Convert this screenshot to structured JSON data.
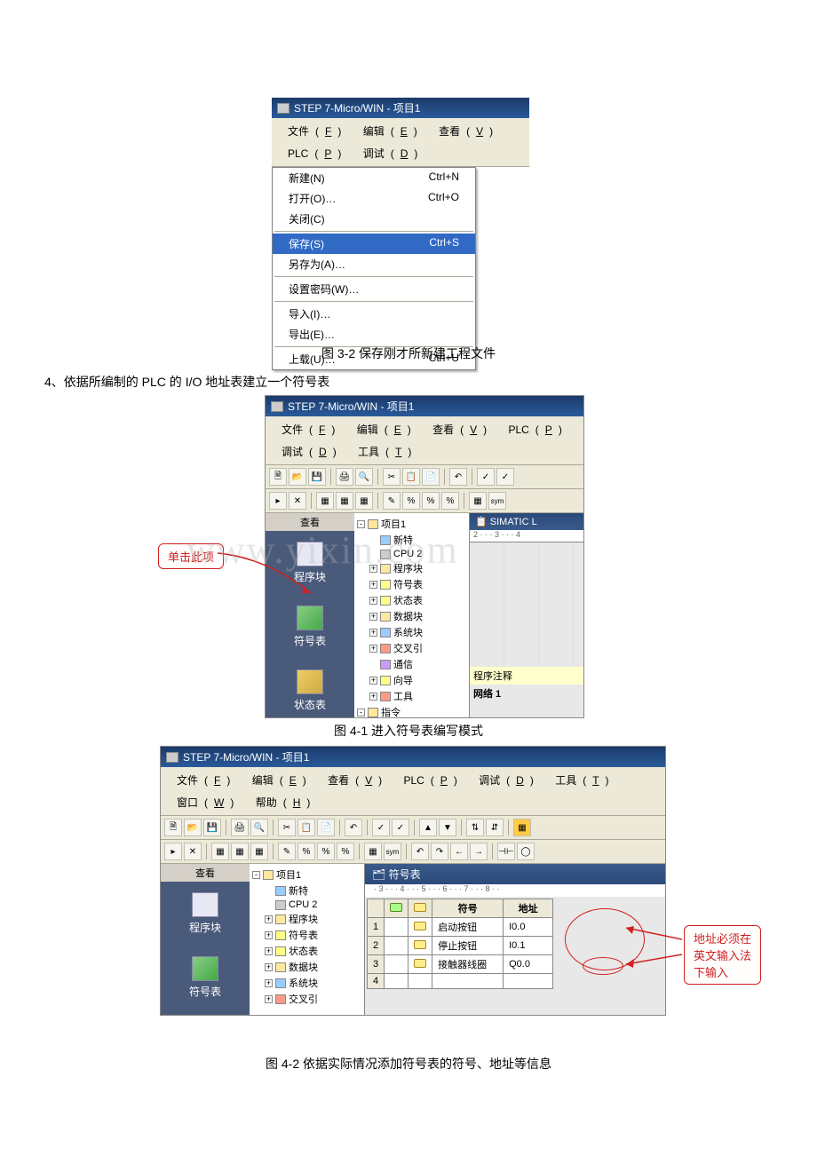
{
  "fig32": {
    "title": "STEP 7-Micro/WIN - 项目1",
    "menubar": [
      {
        "label": "文件",
        "u": "F"
      },
      {
        "label": "编辑",
        "u": "E"
      },
      {
        "label": "查看",
        "u": "V"
      },
      {
        "label": "PLC",
        "u": "P"
      },
      {
        "label": "调试",
        "u": "D"
      }
    ],
    "menuItems": [
      {
        "label": "新建(N)",
        "shortcut": "Ctrl+N"
      },
      {
        "label": "打开(O)…",
        "shortcut": "Ctrl+O"
      },
      {
        "label": "关闭(C)",
        "shortcut": ""
      },
      {
        "sep": true
      },
      {
        "label": "保存(S)",
        "shortcut": "Ctrl+S",
        "hl": true
      },
      {
        "label": "另存为(A)…",
        "shortcut": ""
      },
      {
        "sep": true
      },
      {
        "label": "设置密码(W)…",
        "shortcut": ""
      },
      {
        "sep": true
      },
      {
        "label": "导入(I)…",
        "shortcut": ""
      },
      {
        "label": "导出(E)…",
        "shortcut": ""
      },
      {
        "sep": true
      },
      {
        "label": "上载(U)…",
        "shortcut": "Ctrl+U"
      }
    ],
    "caption": "图 3-2   保存刚才所新建工程文件"
  },
  "instruction4": "4、依据所编制的 PLC 的 I/O 地址表建立一个符号表",
  "fig41": {
    "title": "STEP 7-Micro/WIN - 项目1",
    "menubar": [
      {
        "label": "文件",
        "u": "F"
      },
      {
        "label": "编辑",
        "u": "E"
      },
      {
        "label": "查看",
        "u": "V"
      },
      {
        "label": "PLC",
        "u": "P"
      },
      {
        "label": "调试",
        "u": "D"
      },
      {
        "label": "工具",
        "u": "T"
      }
    ],
    "viewHeader": "查看",
    "viewItems": [
      {
        "label": "程序块",
        "icon": "prog"
      },
      {
        "label": "符号表",
        "icon": "symbol"
      },
      {
        "label": "状态表",
        "icon": "status"
      }
    ],
    "tree": [
      {
        "label": "项目1",
        "icon": "folder",
        "indent": 0,
        "expand": "-"
      },
      {
        "label": "新特",
        "icon": "blue",
        "indent": 1
      },
      {
        "label": "CPU 2",
        "icon": "gray",
        "indent": 1
      },
      {
        "label": "程序块",
        "icon": "folder",
        "indent": 1,
        "expand": "+"
      },
      {
        "label": "符号表",
        "icon": "yellow",
        "indent": 1,
        "expand": "+"
      },
      {
        "label": "状态表",
        "icon": "yellow",
        "indent": 1,
        "expand": "+"
      },
      {
        "label": "数据块",
        "icon": "folder",
        "indent": 1,
        "expand": "+"
      },
      {
        "label": "系统块",
        "icon": "blue",
        "indent": 1,
        "expand": "+"
      },
      {
        "label": "交叉引",
        "icon": "red",
        "indent": 1,
        "expand": "+"
      },
      {
        "label": "通信",
        "icon": "purple",
        "indent": 1
      },
      {
        "label": "向导",
        "icon": "yellow",
        "indent": 1,
        "expand": "+"
      },
      {
        "label": "工具",
        "icon": "red",
        "indent": 1,
        "expand": "+"
      },
      {
        "label": "指令",
        "icon": "folder",
        "indent": 0,
        "expand": "-"
      }
    ],
    "simatic": "SIMATIC L",
    "rulerText": "2 · · · 3 · · · 4",
    "programComment": "程序注释",
    "network": "网络 1",
    "caption": "图 4-1 进入符号表编写模式",
    "callout1": "单击此项"
  },
  "fig42": {
    "title": "STEP 7-Micro/WIN - 项目1",
    "menubar": [
      {
        "label": "文件",
        "u": "F"
      },
      {
        "label": "编辑",
        "u": "E"
      },
      {
        "label": "查看",
        "u": "V"
      },
      {
        "label": "PLC",
        "u": "P"
      },
      {
        "label": "调试",
        "u": "D"
      },
      {
        "label": "工具",
        "u": "T"
      },
      {
        "label": "窗口",
        "u": "W"
      },
      {
        "label": "帮助",
        "u": "H"
      }
    ],
    "viewHeader": "查看",
    "viewItems": [
      {
        "label": "程序块",
        "icon": "prog"
      },
      {
        "label": "符号表",
        "icon": "symbol"
      }
    ],
    "tree": [
      {
        "label": "项目1",
        "icon": "folder",
        "indent": 0,
        "expand": "-"
      },
      {
        "label": "新特",
        "icon": "blue",
        "indent": 1
      },
      {
        "label": "CPU 2",
        "icon": "gray",
        "indent": 1
      },
      {
        "label": "程序块",
        "icon": "folder",
        "indent": 1,
        "expand": "+"
      },
      {
        "label": "符号表",
        "icon": "yellow",
        "indent": 1,
        "expand": "+"
      },
      {
        "label": "状态表",
        "icon": "yellow",
        "indent": 1,
        "expand": "+"
      },
      {
        "label": "数据块",
        "icon": "folder",
        "indent": 1,
        "expand": "+"
      },
      {
        "label": "系统块",
        "icon": "blue",
        "indent": 1,
        "expand": "+"
      },
      {
        "label": "交叉引",
        "icon": "red",
        "indent": 1,
        "expand": "+"
      }
    ],
    "symTableTitle": "符号表",
    "rulerText": "· 3 · · · 4 · · · 5 · · · 6 · · · 7 · · · 8 · ·",
    "columns": {
      "icon1": "",
      "icon2": "",
      "symbol": "符号",
      "address": "地址"
    },
    "rows": [
      {
        "n": 1,
        "symbol": "启动按钮",
        "address": "I0.0"
      },
      {
        "n": 2,
        "symbol": "停止按钮",
        "address": "I0.1"
      },
      {
        "n": 3,
        "symbol": "接触器线圈",
        "address": "Q0.0"
      },
      {
        "n": 4,
        "symbol": "",
        "address": ""
      }
    ],
    "caption": "图 4-2 依据实际情况添加符号表的符号、地址等信息",
    "callout2_l1": "地址必须在",
    "callout2_l2": "英文输入法",
    "callout2_l3": "下输入"
  },
  "watermark": "www.yixin.com"
}
